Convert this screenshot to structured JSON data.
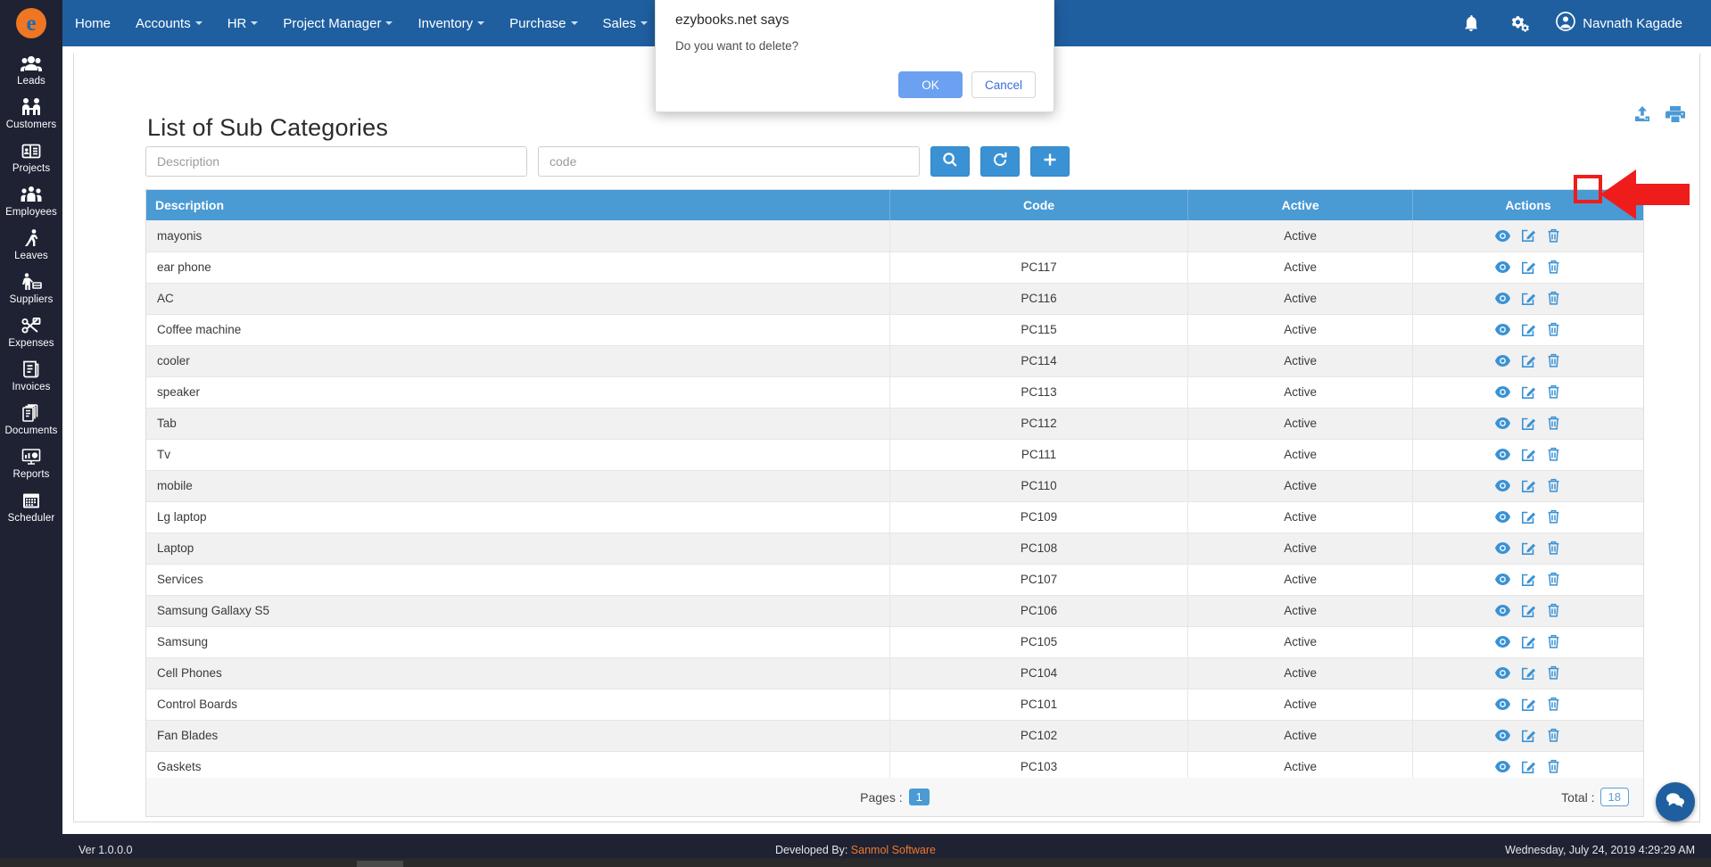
{
  "brand": {
    "logo_letter": "e",
    "accent": "#ef7622",
    "navbar_color": "#1f5fa0",
    "sidebar_color": "#1e2233",
    "table_header_color": "#4a9ad4"
  },
  "sidebar": {
    "items": [
      {
        "label": "Leads",
        "icon": "leads-icon"
      },
      {
        "label": "Customers",
        "icon": "customers-icon"
      },
      {
        "label": "Projects",
        "icon": "projects-icon"
      },
      {
        "label": "Employees",
        "icon": "employees-icon"
      },
      {
        "label": "Leaves",
        "icon": "leaves-icon"
      },
      {
        "label": "Suppliers",
        "icon": "suppliers-icon"
      },
      {
        "label": "Expenses",
        "icon": "expenses-icon"
      },
      {
        "label": "Invoices",
        "icon": "invoices-icon"
      },
      {
        "label": "Documents",
        "icon": "documents-icon"
      },
      {
        "label": "Reports",
        "icon": "reports-icon"
      },
      {
        "label": "Scheduler",
        "icon": "scheduler-icon"
      }
    ]
  },
  "topnav": {
    "items": [
      {
        "label": "Home",
        "has_caret": false
      },
      {
        "label": "Accounts",
        "has_caret": true
      },
      {
        "label": "HR",
        "has_caret": true
      },
      {
        "label": "Project Manager",
        "has_caret": true
      },
      {
        "label": "Inventory",
        "has_caret": true
      },
      {
        "label": "Purchase",
        "has_caret": true
      },
      {
        "label": "Sales",
        "has_caret": true
      }
    ],
    "notifications_icon": "bell-icon",
    "settings_icon": "gears-icon",
    "user_name": "Navnath Kagade"
  },
  "page": {
    "title": "List of Sub Categories",
    "export_icon": "upload-icon",
    "print_icon": "print-icon"
  },
  "search": {
    "description_placeholder": "Description",
    "description_value": "",
    "code_placeholder": "code",
    "code_value": "",
    "search_button": "search-icon",
    "refresh_button": "refresh-icon",
    "add_button": "plus-icon"
  },
  "table": {
    "columns": [
      "Description",
      "Code",
      "Active",
      "Actions"
    ],
    "rows": [
      {
        "description": "mayonis",
        "code": "",
        "active": "Active"
      },
      {
        "description": "ear phone",
        "code": "PC117",
        "active": "Active"
      },
      {
        "description": "AC",
        "code": "PC116",
        "active": "Active"
      },
      {
        "description": "Coffee machine",
        "code": "PC115",
        "active": "Active"
      },
      {
        "description": "cooler",
        "code": "PC114",
        "active": "Active"
      },
      {
        "description": "speaker",
        "code": "PC113",
        "active": "Active"
      },
      {
        "description": "Tab",
        "code": "PC112",
        "active": "Active"
      },
      {
        "description": "Tv",
        "code": "PC111",
        "active": "Active"
      },
      {
        "description": "mobile",
        "code": "PC110",
        "active": "Active"
      },
      {
        "description": "Lg laptop",
        "code": "PC109",
        "active": "Active"
      },
      {
        "description": "Laptop",
        "code": "PC108",
        "active": "Active"
      },
      {
        "description": "Services",
        "code": "PC107",
        "active": "Active"
      },
      {
        "description": "Samsung Gallaxy S5",
        "code": "PC106",
        "active": "Active"
      },
      {
        "description": "Samsung",
        "code": "PC105",
        "active": "Active"
      },
      {
        "description": "Cell Phones",
        "code": "PC104",
        "active": "Active"
      },
      {
        "description": "Control Boards",
        "code": "PC101",
        "active": "Active"
      },
      {
        "description": "Fan Blades",
        "code": "PC102",
        "active": "Active"
      },
      {
        "description": "Gaskets",
        "code": "PC103",
        "active": "Active"
      }
    ],
    "row_actions": [
      "view-icon",
      "edit-icon",
      "delete-icon"
    ],
    "pages_label": "Pages :",
    "current_page": "1",
    "total_label": "Total :",
    "total_value": "18"
  },
  "dialog": {
    "title": "ezybooks.net says",
    "message": "Do you want to delete?",
    "ok_label": "OK",
    "cancel_label": "Cancel"
  },
  "annotation": {
    "highlight_color": "#ef1c1c",
    "target": "delete-icon-row-1"
  },
  "chat": {
    "icon": "chat-bubble-icon"
  },
  "footer": {
    "version": "Ver 1.0.0.0",
    "developed_by_label": "Developed By:",
    "developer": "Sanmol Software",
    "datetime": "Wednesday, July 24, 2019 4:29:29 AM"
  }
}
